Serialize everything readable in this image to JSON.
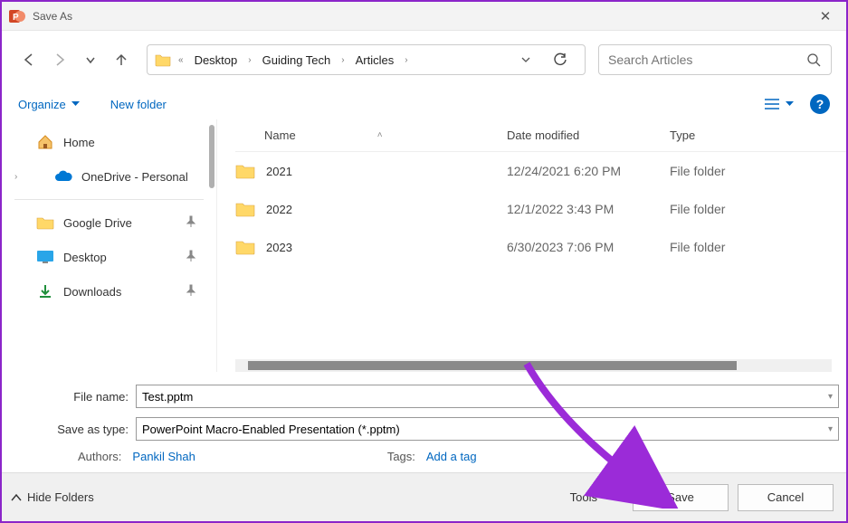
{
  "window": {
    "title": "Save As"
  },
  "breadcrumb": {
    "items": [
      "Desktop",
      "Guiding Tech",
      "Articles"
    ]
  },
  "search": {
    "placeholder": "Search Articles"
  },
  "toolbar": {
    "organize": "Organize",
    "new_folder": "New folder"
  },
  "sidebar": {
    "items": [
      {
        "label": "Home",
        "icon": "home"
      },
      {
        "label": "OneDrive - Personal",
        "icon": "onedrive",
        "expandable": true
      },
      {
        "label": "Google Drive",
        "icon": "folder-yellow",
        "pinned": true
      },
      {
        "label": "Desktop",
        "icon": "desktop",
        "pinned": true
      },
      {
        "label": "Downloads",
        "icon": "download",
        "pinned": true
      }
    ]
  },
  "columns": {
    "name": "Name",
    "date": "Date modified",
    "type": "Type"
  },
  "files": [
    {
      "name": "2021",
      "date": "12/24/2021 6:20 PM",
      "type": "File folder"
    },
    {
      "name": "2022",
      "date": "12/1/2022 3:43 PM",
      "type": "File folder"
    },
    {
      "name": "2023",
      "date": "6/30/2023 7:06 PM",
      "type": "File folder"
    }
  ],
  "form": {
    "filename_label": "File name:",
    "filename_value": "Test.pptm",
    "filetype_label": "Save as type:",
    "filetype_value": "PowerPoint Macro-Enabled Presentation (*.pptm)",
    "authors_label": "Authors:",
    "authors_value": "Pankil Shah",
    "tags_label": "Tags:",
    "tags_value": "Add a tag"
  },
  "footer": {
    "hide_folders": "Hide Folders",
    "tools": "Tools",
    "save": "Save",
    "cancel": "Cancel"
  }
}
